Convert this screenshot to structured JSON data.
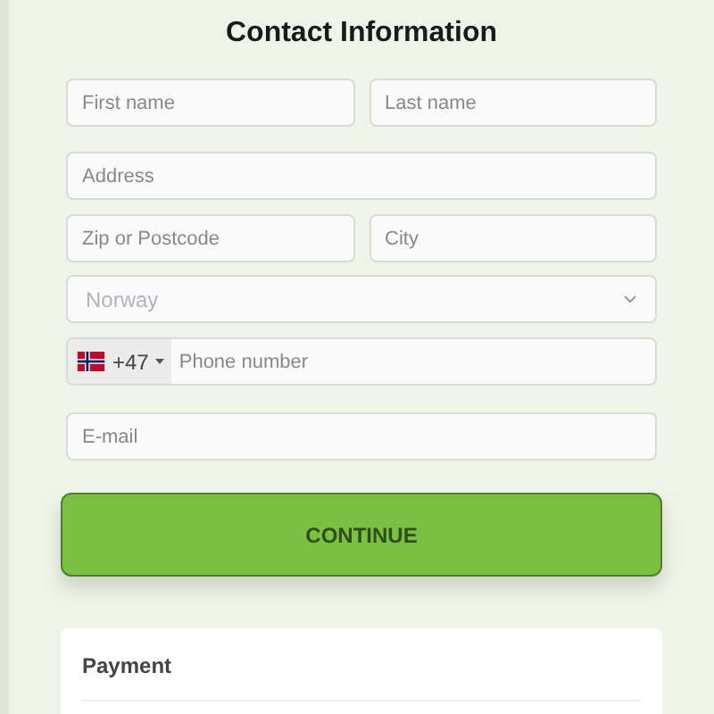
{
  "heading": "Contact Information",
  "name_fields": [
    {
      "placeholder": "First name"
    },
    {
      "placeholder": "Last name"
    }
  ],
  "address": {
    "placeholder": "Address"
  },
  "location_fields": [
    {
      "placeholder": "Zip or Postcode"
    },
    {
      "placeholder": "City"
    }
  ],
  "country": {
    "value": "Norway"
  },
  "phone": {
    "dial_code": "+47",
    "placeholder": "Phone number"
  },
  "email": {
    "placeholder": "E-mail"
  },
  "continue_button": "CONTINUE",
  "payment": {
    "title": "Payment"
  }
}
